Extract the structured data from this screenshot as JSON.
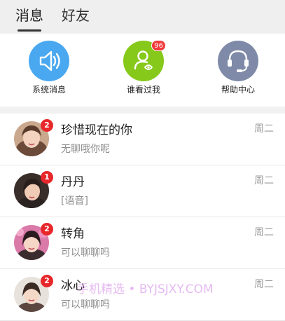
{
  "tabs": [
    {
      "label": "消息",
      "active": true
    },
    {
      "label": "好友",
      "active": false
    }
  ],
  "actions": [
    {
      "label": "系统消息",
      "icon": "speaker-icon",
      "color": "#4aa8f0"
    },
    {
      "label": "谁看过我",
      "icon": "person-eye-icon",
      "color": "#86c91a",
      "badge": "96"
    },
    {
      "label": "帮助中心",
      "icon": "headset-icon",
      "color": "#7e8aa8"
    }
  ],
  "conversations": [
    {
      "name": "珍惜现在的你",
      "preview": "无聊哦你呢",
      "time": "周二",
      "unread": "2"
    },
    {
      "name": "丹丹",
      "preview": "[语音]",
      "time": "周二",
      "unread": "1"
    },
    {
      "name": "转角",
      "preview": "可以聊聊吗",
      "time": "周二",
      "unread": "2"
    },
    {
      "name": "冰心",
      "preview": "可以聊聊吗",
      "time": "周二",
      "unread": "2"
    }
  ],
  "watermark": "手机精选 • BYJSJXY.COM",
  "colors": {
    "badge_red": "#e8272a",
    "tab_bar_bg": "#efefef"
  }
}
